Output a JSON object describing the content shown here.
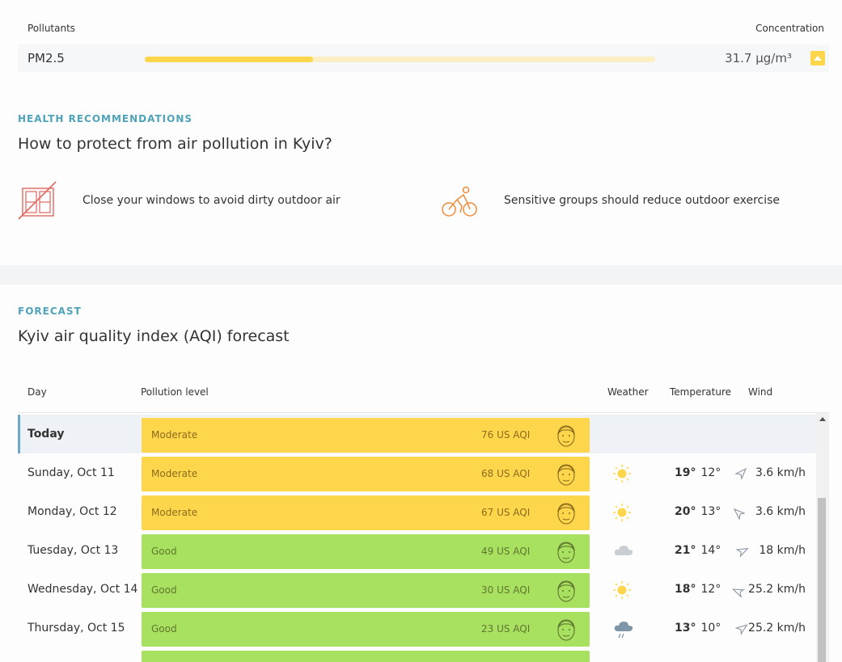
{
  "pollutants": {
    "header_left": "Pollutants",
    "header_right": "Concentration",
    "item": {
      "name": "PM2.5",
      "value": "31.7 µg/m³",
      "bar_level": 0.33,
      "color": "#fdd64b"
    }
  },
  "health": {
    "eyebrow": "HEALTH RECOMMENDATIONS",
    "title": "How to protect from air pollution in Kyiv?",
    "recs": [
      {
        "text": "Close your windows to avoid dirty outdoor air",
        "icon": "closed-window-icon"
      },
      {
        "text": "Sensitive groups should reduce outdoor exercise",
        "icon": "cyclist-icon"
      }
    ]
  },
  "forecast": {
    "eyebrow": "FORECAST",
    "title": "Kyiv air quality index (AQI) forecast",
    "columns": {
      "day": "Day",
      "level": "Pollution level",
      "weather": "Weather",
      "temperature": "Temperature",
      "wind": "Wind"
    },
    "rows": [
      {
        "day": "Today",
        "level": "Moderate",
        "aqi": "76 US AQI",
        "weather": "",
        "high": "",
        "low": "",
        "wind": ""
      },
      {
        "day": "Sunday, Oct 11",
        "level": "Moderate",
        "aqi": "68 US AQI",
        "weather": "sun-icon",
        "high": "19°",
        "low": "12°",
        "wind": "3.6 km/h"
      },
      {
        "day": "Monday, Oct 12",
        "level": "Moderate",
        "aqi": "67 US AQI",
        "weather": "sun-icon",
        "high": "20°",
        "low": "13°",
        "wind": "3.6 km/h"
      },
      {
        "day": "Tuesday, Oct 13",
        "level": "Good",
        "aqi": "49 US AQI",
        "weather": "cloud-icon",
        "high": "21°",
        "low": "14°",
        "wind": "18 km/h"
      },
      {
        "day": "Wednesday, Oct 14",
        "level": "Good",
        "aqi": "30 US AQI",
        "weather": "sun-icon",
        "high": "18°",
        "low": "12°",
        "wind": "25.2 km/h"
      },
      {
        "day": "Thursday, Oct 15",
        "level": "Good",
        "aqi": "23 US AQI",
        "weather": "rain-icon",
        "high": "13°",
        "low": "10°",
        "wind": "25.2 km/h"
      }
    ]
  },
  "colors": {
    "moderate": "#fdd64b",
    "good": "#a8e05f",
    "accent": "#4fa3b8"
  }
}
